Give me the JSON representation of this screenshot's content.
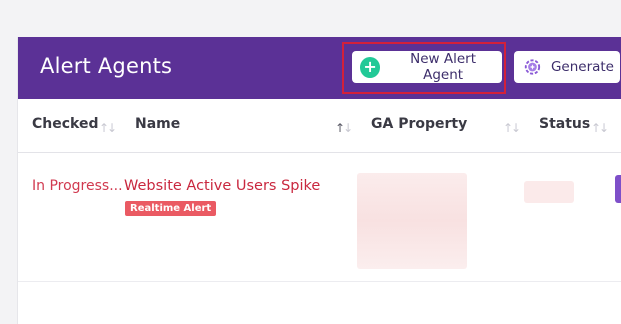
{
  "header": {
    "title": "Alert Agents",
    "new_button_label": "New Alert Agent",
    "generate_button_label": "Generate"
  },
  "icons": {
    "new": "plus-circle-icon",
    "generate": "gear-sparkle-icon",
    "sort": "sort-arrows-icon"
  },
  "columns": [
    {
      "label": "Checked"
    },
    {
      "label": "Name"
    },
    {
      "label": "GA Property"
    },
    {
      "label": "Status"
    }
  ],
  "rows": [
    {
      "checked": "In Progress...",
      "name": "Website Active Users Spike",
      "badge": "Realtime Alert"
    }
  ],
  "colors": {
    "header_bg": "#5b3196",
    "accent_green": "#22c997",
    "error_red": "#d1394f",
    "badge_red": "#ea5a63",
    "highlight_border": "#d3203a"
  }
}
